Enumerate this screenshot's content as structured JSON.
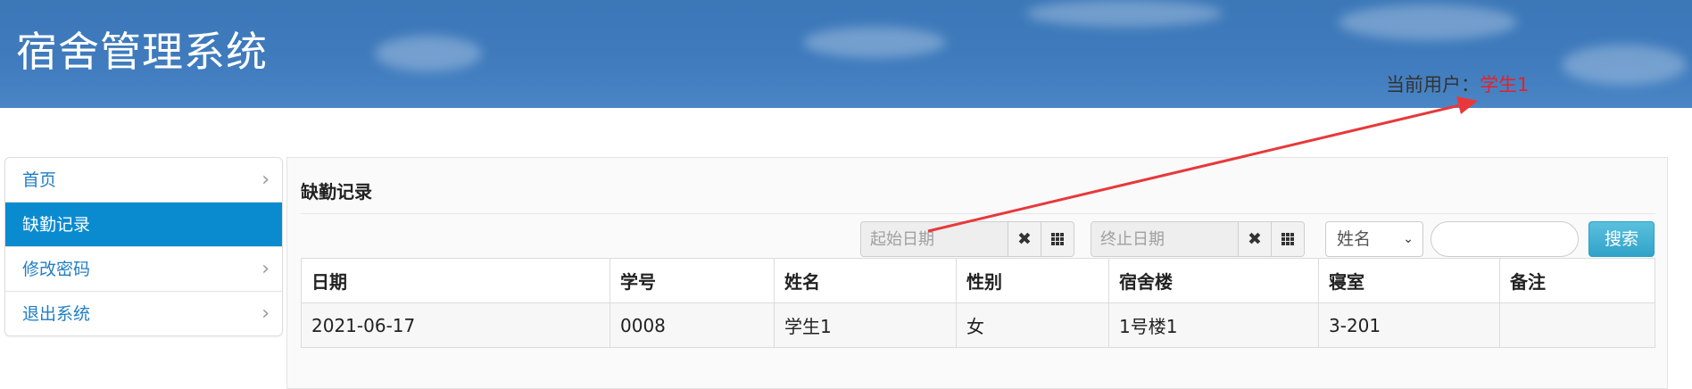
{
  "header": {
    "app_title": "宿舍管理系统",
    "user_label": "当前用户：",
    "user_name": "学生1"
  },
  "sidebar": {
    "items": [
      {
        "label": "首页",
        "active": false
      },
      {
        "label": "缺勤记录",
        "active": true
      },
      {
        "label": "修改密码",
        "active": false
      },
      {
        "label": "退出系统",
        "active": false
      }
    ]
  },
  "main": {
    "title": "缺勤记录",
    "filters": {
      "start_date_placeholder": "起始日期",
      "end_date_placeholder": "终止日期",
      "field_select": "姓名",
      "search_value": "",
      "search_button": "搜索"
    },
    "table": {
      "columns": [
        "日期",
        "学号",
        "姓名",
        "性别",
        "宿舍楼",
        "寝室",
        "备注"
      ],
      "rows": [
        [
          "2021-06-17",
          "0008",
          "学生1",
          "女",
          "1号楼1",
          "3-201",
          ""
        ]
      ]
    }
  },
  "colors": {
    "header_bg": "#3f7bbd",
    "active_nav": "#0a8bd0",
    "link": "#1f7ec4",
    "user_name": "#e8202a",
    "search_button": "#31a3c9",
    "annotation_arrow": "#e8383a"
  },
  "icons": {
    "clear_date": "clear-icon",
    "calendar": "calendar-grid-icon",
    "nav_chevron": "chevron-right-icon",
    "select_caret": "chevron-down-icon"
  }
}
